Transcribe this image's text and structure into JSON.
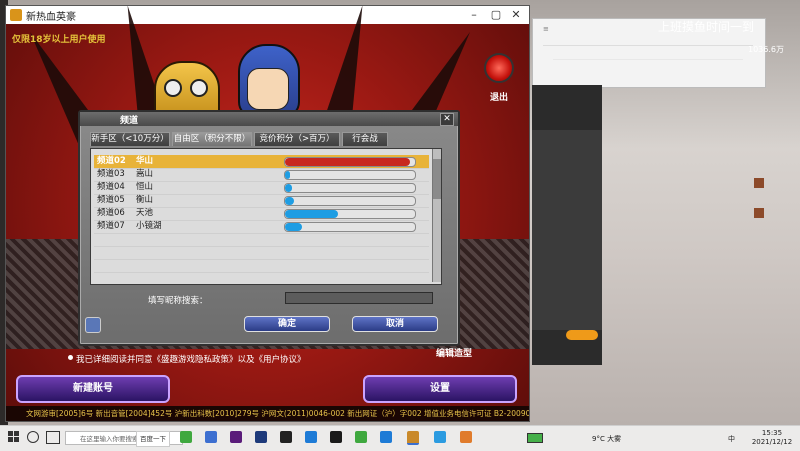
{
  "game_window": {
    "title": "新热血英豪",
    "age_note": "仅限18岁以上用户使用",
    "exit_label": "退出",
    "agree_text": "我已详细阅读并同意《盛趣游戏隐私政策》以及《用户协议》",
    "new_account": "新建账号",
    "settings": "设置",
    "edit_role": "编辑造型",
    "footer": "文网游审[2005]6号 新出音管[2004]452号 沪新出科数[2010]279号 沪网文(2011)0046-002 新出网证（沪）字002 增值业务电信许可证 B2-20090046"
  },
  "dialog": {
    "title": "频道",
    "tabs": [
      "新手区（<10万分）",
      "自由区（积分不限）",
      "竞价积分（>百万）",
      "行会战"
    ],
    "search_label": "填写昵称搜索：",
    "search_value": "",
    "ok": "确定",
    "cancel": "取消",
    "channels": [
      {
        "channel": "频道02",
        "name": "华山",
        "load": 0.96,
        "selected": true
      },
      {
        "channel": "频道03",
        "name": "嵩山",
        "load": 0.04,
        "selected": false
      },
      {
        "channel": "频道04",
        "name": "恒山",
        "load": 0.05,
        "selected": false
      },
      {
        "channel": "频道05",
        "name": "衡山",
        "load": 0.07,
        "selected": false
      },
      {
        "channel": "频道06",
        "name": "天池",
        "load": 0.41,
        "selected": false
      },
      {
        "channel": "频道07",
        "name": "小镜湖",
        "load": 0.13,
        "selected": false
      }
    ]
  },
  "stream": {
    "title": "上班摸鱼时间一到",
    "count": "1036.6万"
  },
  "taskbar": {
    "search_placeholder": "在这里输入你要搜索的内容",
    "search_button": "百度一下",
    "weather": "9°C 大雾",
    "ime": "中",
    "time": "15:35",
    "date": "2021/12/12"
  },
  "colors": {
    "selected_row": "#e8b339",
    "bar_red": "#c8281f",
    "bar_blue": "#1e9de3"
  }
}
